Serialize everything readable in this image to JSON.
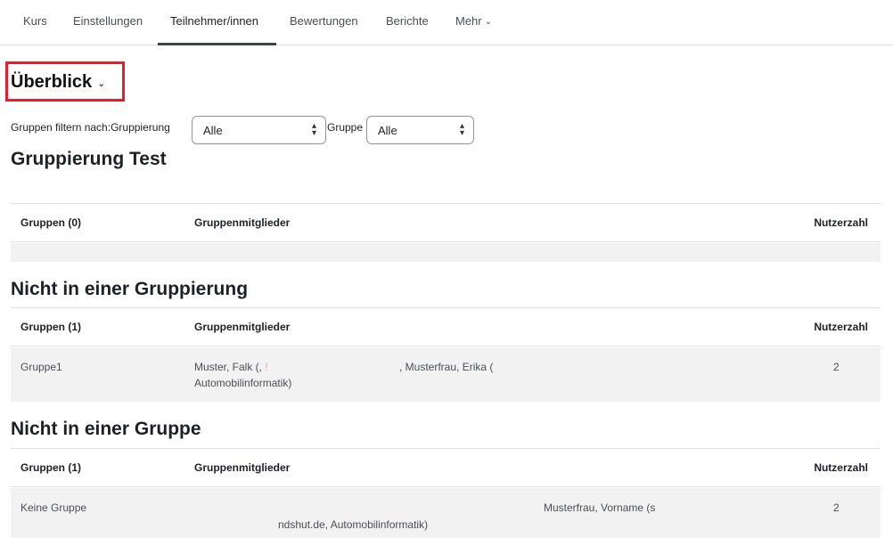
{
  "nav": {
    "tabs": [
      {
        "label": "Kurs"
      },
      {
        "label": "Einstellungen"
      },
      {
        "label": "Teilnehmer/innen"
      },
      {
        "label": "Bewertungen"
      },
      {
        "label": "Berichte"
      },
      {
        "label": "Mehr"
      }
    ]
  },
  "page": {
    "title": "Überblick"
  },
  "filters": {
    "label": "Gruppen filtern nach:",
    "grouping_label": "Gruppierung",
    "grouping_value": "Alle",
    "group_label": "Gruppe",
    "group_value": "Alle"
  },
  "sections": [
    {
      "heading": "Gruppierung Test",
      "columns": [
        "Gruppen (0)",
        "Gruppenmitglieder",
        "Nutzerzahl"
      ]
    },
    {
      "heading": "Nicht in einer Gruppierung",
      "columns": [
        "Gruppen (1)",
        "Gruppenmitglieder",
        "Nutzerzahl"
      ],
      "row": {
        "group": "Gruppe1",
        "members_a": "Muster, Falk (,",
        "members_b": ", Musterfrau, Erika (",
        "members_c": "Automobilinformatik)",
        "count": "2"
      }
    },
    {
      "heading": "Nicht in einer Gruppe",
      "columns": [
        "Gruppen (1)",
        "Gruppenmitglieder",
        "Nutzerzahl"
      ],
      "row": {
        "group": "Keine Gruppe",
        "members_a": "Musterfrau, Vorname (s",
        "members_b": "ndshut.de, Automobilinformatik)",
        "count": "2"
      }
    }
  ],
  "colors": {
    "highlight_border": "#e0202a",
    "row_background": "#f2f2f2"
  }
}
